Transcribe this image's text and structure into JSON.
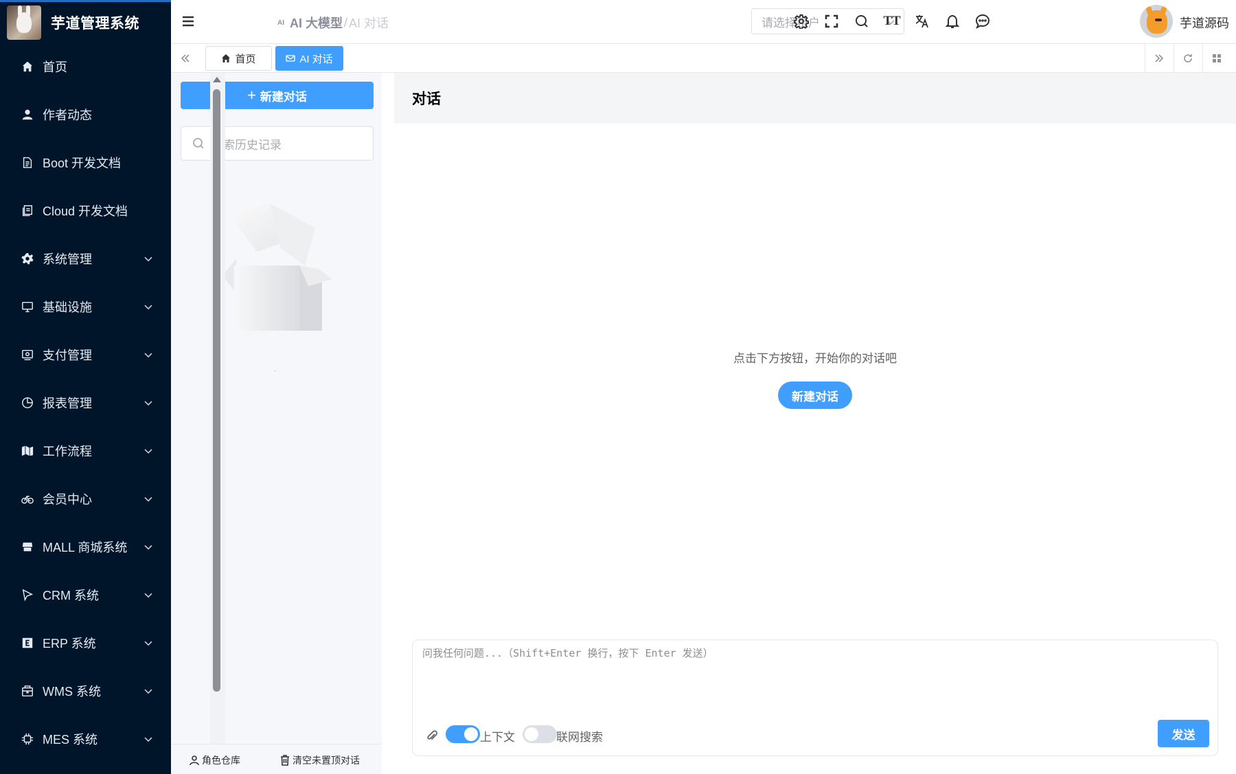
{
  "app": {
    "title": "芋道管理系统"
  },
  "sidebar": {
    "items": [
      {
        "label": "首页",
        "icon": "home-icon",
        "expandable": false
      },
      {
        "label": "作者动态",
        "icon": "user-icon",
        "expandable": false
      },
      {
        "label": "Boot 开发文档",
        "icon": "document-icon",
        "expandable": false
      },
      {
        "label": "Cloud 开发文档",
        "icon": "documents-icon",
        "expandable": false
      },
      {
        "label": "系统管理",
        "icon": "gear-icon",
        "expandable": true
      },
      {
        "label": "基础设施",
        "icon": "monitor-icon",
        "expandable": true
      },
      {
        "label": "支付管理",
        "icon": "wallet-icon",
        "expandable": true
      },
      {
        "label": "报表管理",
        "icon": "pie-chart-icon",
        "expandable": true
      },
      {
        "label": "工作流程",
        "icon": "workflow-icon",
        "expandable": true
      },
      {
        "label": "会员中心",
        "icon": "bicycle-icon",
        "expandable": true
      },
      {
        "label": "MALL 商城系统",
        "icon": "store-icon",
        "expandable": true
      },
      {
        "label": "CRM 系统",
        "icon": "crm-icon",
        "expandable": true
      },
      {
        "label": "ERP 系统",
        "icon": "erp-icon",
        "expandable": true
      },
      {
        "label": "WMS 系统",
        "icon": "package-icon",
        "expandable": true
      },
      {
        "label": "MES 系统",
        "icon": "chip-icon",
        "expandable": true
      }
    ]
  },
  "header": {
    "breadcrumb": {
      "mark": "AI",
      "level1": "AI 大模型",
      "separator": "/",
      "level2": "AI 对话"
    },
    "tenant_placeholder": "请选择租户",
    "tools": [
      "settings-icon",
      "fullscreen-icon",
      "search-icon",
      "font-size-icon",
      "translate-icon",
      "bell-icon",
      "message-icon"
    ],
    "font_size_glyph": "TT",
    "username": "芋道源码"
  },
  "tags": [
    {
      "label": "首页",
      "icon": "home-icon",
      "active": false
    },
    {
      "label": "AI 对话",
      "icon": "mail-icon",
      "active": true
    }
  ],
  "conversation_panel": {
    "new_button": "新建对话",
    "new_button_glyph": "+",
    "search_placeholder": "搜索历史记录",
    "empty_description": "·",
    "footer": {
      "role_library": "角色仓库",
      "clear_unpinned": "清空未置顶对话"
    }
  },
  "chat": {
    "title": "对话",
    "empty_message": "点击下方按钮，开始你的对话吧",
    "new_button": "新建对话",
    "input_placeholder": "问我任何问题...（Shift+Enter 换行，按下 Enter 发送）",
    "context_label": "上下文",
    "context_enabled": true,
    "web_search_label": "联网搜索",
    "web_search_enabled": false,
    "send_button": "发送"
  },
  "colors": {
    "sidebar_bg": "#001529",
    "primary": "#409eff",
    "chat_header_bg": "#f4f5f7",
    "panel_bg": "#f5f7fa"
  }
}
